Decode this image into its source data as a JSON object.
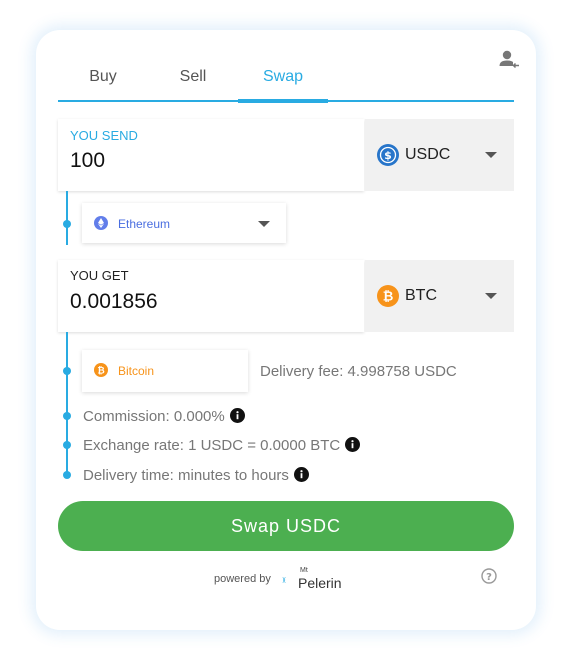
{
  "tabs": [
    {
      "label": "Buy",
      "active": false
    },
    {
      "label": "Sell",
      "active": false
    },
    {
      "label": "Swap",
      "active": true
    }
  ],
  "send": {
    "label": "YOU SEND",
    "value": "100",
    "currency": "USDC",
    "currency_icon": "usdc-icon",
    "network": "Ethereum",
    "network_icon": "ethereum-icon"
  },
  "get": {
    "label": "YOU GET",
    "value": "0.001856",
    "currency": "BTC",
    "currency_icon": "bitcoin-icon",
    "network": "Bitcoin",
    "network_icon": "bitcoin-icon"
  },
  "fees": {
    "delivery_fee": "Delivery fee: 4.998758 USDC",
    "commission": "Commission: 0.000%",
    "exchange_rate": "Exchange rate: 1 USDC = 0.0000 BTC",
    "delivery_time": "Delivery time: minutes to hours"
  },
  "action": {
    "label": "Swap USDC"
  },
  "footer": {
    "powered_by": "powered by",
    "brand_prefix": "Mt",
    "brand_name": "Pelerin"
  },
  "colors": {
    "accent": "#29abe2",
    "button": "#4caf50",
    "usdc": "#2775ca",
    "btc": "#f7931a",
    "eth": "#627eea"
  }
}
